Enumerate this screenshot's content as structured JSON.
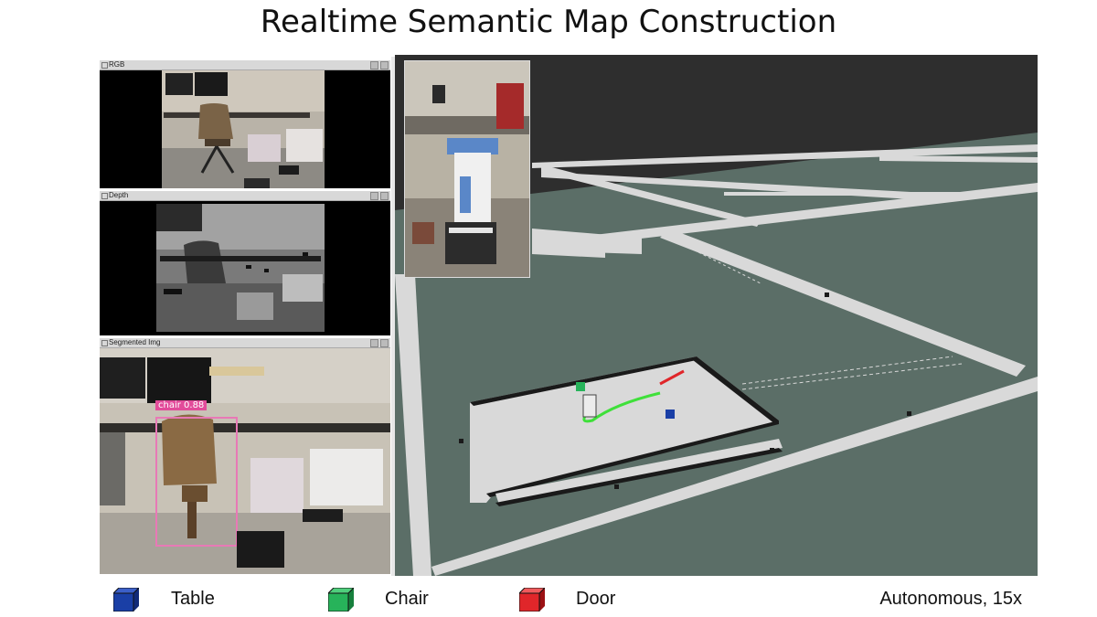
{
  "title": "Realtime Semantic Map Construction",
  "panels": {
    "rgb": "RGB",
    "depth": "Depth",
    "segmented": "Segmented Img"
  },
  "detection": {
    "label": "chair 0.88"
  },
  "legend": [
    {
      "label": "Table",
      "color": "#1a3fa6"
    },
    {
      "label": "Chair",
      "color": "#27b35a"
    },
    {
      "label": "Door",
      "color": "#e0262a"
    }
  ],
  "status": "Autonomous, 15x",
  "colors": {
    "map_floor": "#5b6e67",
    "map_free": "#d9d9d9",
    "bbox": "#e879b6",
    "path": "#3fe03a"
  }
}
